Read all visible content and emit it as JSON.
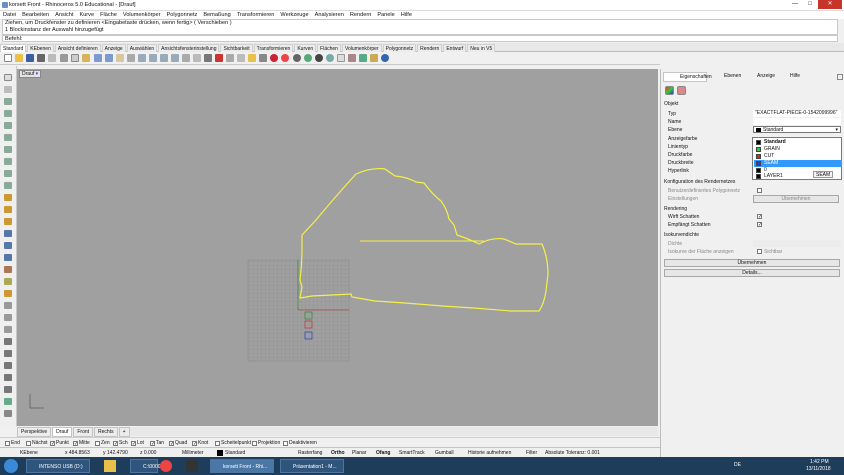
{
  "window": {
    "title": "korsett Front - Rhinoceros 5.0 Educational - [Drauf]",
    "min_label": "—",
    "max_label": "□",
    "close_label": "✕"
  },
  "menu": [
    "Datei",
    "Bearbeiten",
    "Ansicht",
    "Kurve",
    "Fläche",
    "Volumenkörper",
    "Polygonnetz",
    "Bemaßung",
    "Transformieren",
    "Werkzeuge",
    "Analysieren",
    "Rendern",
    "Panele",
    "Hilfe"
  ],
  "command": {
    "history": [
      "Ziehen, um Druckfenster zu definieren <Eingabetaste drücken, wenn fertig> ( Verschieben )",
      "1 Blockinstanz der Auswahl hinzugefügt"
    ],
    "prompt": "Befehl:"
  },
  "toolbar_tabs": [
    "Standard",
    "KEbenen",
    "Ansicht definieren",
    "Anzeige",
    "Auswählen",
    "Ansichtsfensterinstellung",
    "Sichtbarkeit",
    "Transformieren",
    "Kurven",
    "Flächen",
    "Volumenkörper",
    "Polygonnetz",
    "Rendern",
    "Entwurf",
    "Neu in V5"
  ],
  "active_toolbar_tab": "Standard",
  "viewport": {
    "label": "Drauf",
    "tabs": [
      "Perspektive",
      "Drauf",
      "Front",
      "Rechts"
    ],
    "active_tab": "Drauf",
    "add_tab": "+",
    "background": "#a0a0a0",
    "curve_color": "#f4f04a"
  },
  "osnap": [
    {
      "label": "End",
      "checked": false
    },
    {
      "label": "Nächst",
      "checked": false
    },
    {
      "label": "Punkt",
      "checked": true
    },
    {
      "label": "Mitte",
      "checked": true
    },
    {
      "label": "Zen",
      "checked": false
    },
    {
      "label": "Sch",
      "checked": true
    },
    {
      "label": "Lot",
      "checked": true
    },
    {
      "label": "Tan",
      "checked": true
    },
    {
      "label": "Quad",
      "checked": true
    },
    {
      "label": "Knot",
      "checked": true
    },
    {
      "label": "Scheitelpunkt",
      "checked": false
    },
    {
      "label": "Projektion",
      "checked": false
    },
    {
      "label": "Deaktivieren",
      "checked": false
    }
  ],
  "status": {
    "cplane": "KEbene",
    "x": "x 484.8563",
    "y": "y 142.4790",
    "z": "z 0.000",
    "units": "Millimeter",
    "layer": "Standard",
    "raster": "Rasterfang",
    "ortho": "Ortho",
    "planar": "Planar",
    "ofang": "Ofang",
    "smarttrack": "SmartTrack",
    "gumball": "Gumball",
    "history": "Historie aufnehmen",
    "filter": "Filter",
    "tolerance": "Absolute Toleranz: 0.001"
  },
  "panel": {
    "tabs": [
      "Eigenschaften",
      "Ebenen",
      "Anzeige",
      "Hilfe"
    ],
    "section_object": "Objekt",
    "rows": [
      {
        "label": "Typ",
        "value": "\"EXACTFLAT-PIECE-0-1542099996\""
      },
      {
        "label": "Name",
        "value": ""
      },
      {
        "label": "Ebene",
        "value": "Standard"
      },
      {
        "label": "Anzeigefarbe",
        "value": ""
      },
      {
        "label": "Linientyp",
        "value": ""
      },
      {
        "label": "Druckfarbe",
        "value": ""
      },
      {
        "label": "Druckbreite",
        "value": ""
      },
      {
        "label": "Hyperlink",
        "value": ""
      }
    ],
    "layer_dropdown": [
      {
        "name": "Standard",
        "color": "#000000",
        "bold": true,
        "selected": false
      },
      {
        "name": "GRAIN",
        "color": "#2ecc2e",
        "bold": false,
        "selected": false
      },
      {
        "name": "CUT",
        "color": "#e02020",
        "bold": false,
        "selected": false
      },
      {
        "name": "SEAM",
        "color": "#1f3fd0",
        "bold": false,
        "selected": true
      },
      {
        "name": "0",
        "color": "#000000",
        "bold": false,
        "selected": false
      },
      {
        "name": "LAYER1",
        "color": "#000000",
        "bold": false,
        "selected": false
      }
    ],
    "seam_tag": "SEAM",
    "section_mesh": "Konfiguration des Rendernetzes",
    "mesh_custom": "Benutzerdefiniertes Polygonnetz",
    "mesh_settings": "Einstellungen",
    "mesh_apply": "Übernehmen",
    "section_render": "Rendering",
    "casts_shadows": "Wirft Schatten",
    "receives_shadows": "Empfängt Schatten",
    "section_iso": "Isokurvendichte",
    "iso_density": "Dichte",
    "iso_show": "Isokurve der Fläche anzeigen",
    "iso_visible": "Sichtbar",
    "apply_button": "Übernehmen",
    "details_button": "Details..."
  },
  "taskbar": {
    "items": [
      "INTENSO USB (D:)",
      "C:\\0000",
      "korsett Front - Rhi...",
      "Präsentation1 - M..."
    ],
    "lang": "DE",
    "time": "1:42 PM",
    "date": "13/11/2018"
  }
}
